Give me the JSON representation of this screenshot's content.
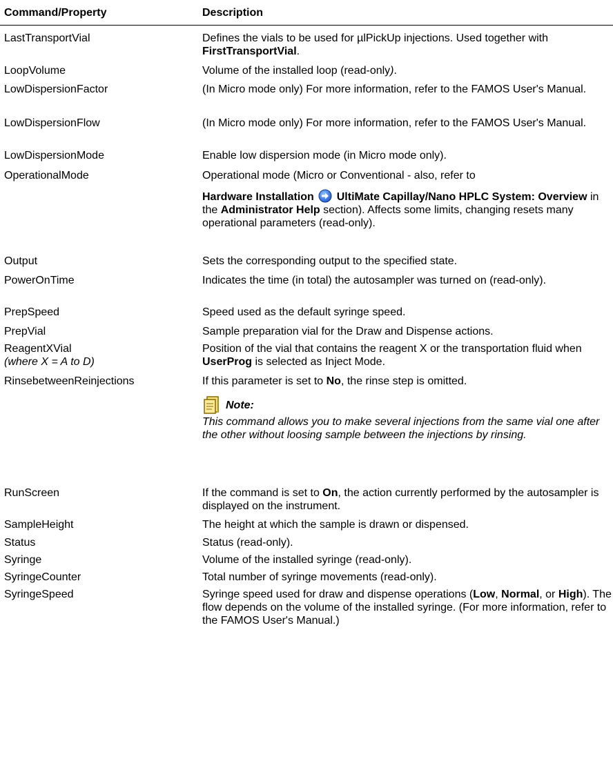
{
  "header": {
    "command_col": "Command/Property",
    "description_col": "Description"
  },
  "rows": [
    {
      "command": "LastTransportVial",
      "desc_1": "Defines the vials to be used for µlPickUp injections. Used together with ",
      "desc_bold_1": "FirstTransportVial",
      "desc_2": "."
    },
    {
      "command": "LoopVolume",
      "desc": "Volume of the installed loop (read-only",
      "desc_italic": ")",
      "desc_end": "."
    },
    {
      "command": "LowDispersionFactor",
      "desc": "(In Micro mode only) For more information, refer to the FAMOS User's Manual."
    },
    {
      "command": "LowDispersionFlow",
      "desc": "(In Micro mode only) For more information, refer to the FAMOS User's Manual."
    },
    {
      "command": "LowDispersionMode",
      "desc": "Enable low dispersion mode (in Micro mode only)."
    },
    {
      "command": "OperationalMode",
      "desc_1": "Operational mode (Micro or Conventional - also, refer to",
      "desc_bold_1": "Hardware Installation",
      "desc_bold_2": "UltiMate Capillay/Nano HPLC System: Overview",
      "desc_2": " in the ",
      "desc_bold_3": "Administrator Help",
      "desc_3": " section). Affects some limits, changing resets many operational parameters (read-only)."
    },
    {
      "command": "Output",
      "desc": "Sets the corresponding output to the specified state."
    },
    {
      "command": "PowerOnTime",
      "desc": "Indicates the time (in total) the autosampler was turned on (read-only)."
    },
    {
      "command": "PrepSpeed",
      "desc": "Speed used as the default syringe speed."
    },
    {
      "command": "PrepVial",
      "desc": "Sample preparation vial for the Draw and Dispense actions."
    },
    {
      "command": "ReagentXVial",
      "command_sub": "(where X = A to D)",
      "desc_1": "Position of the vial that contains the reagent X or the transportation fluid when ",
      "desc_bold_1": "UserProg",
      "desc_2": " is selected as Inject Mode."
    },
    {
      "command": "RinsebetweenReinjections",
      "desc_1": "If this parameter is set to ",
      "desc_bold_1": "No",
      "desc_2": ", the rinse step is omitted.",
      "note_title": "Note:",
      "note_text": "This command allows you to make several injections from the same vial one after the other without loosing sample between the injections by rinsing."
    },
    {
      "command": "RunScreen",
      "desc_1": "If the command is set to ",
      "desc_bold_1": "On",
      "desc_2": ", the action currently performed by the autosampler is displayed on the instrument."
    },
    {
      "command": "SampleHeight",
      "desc": "The height at which the sample is drawn or dispensed."
    },
    {
      "command": "Status",
      "desc": "Status (read-only)."
    },
    {
      "command": "Syringe",
      "desc": "Volume of the installed syringe (read-only)."
    },
    {
      "command": "SyringeCounter",
      "desc": "Total number of syringe movements (read-only)."
    },
    {
      "command": "SyringeSpeed",
      "desc_1": "Syringe speed used for draw and dispense operations (",
      "desc_bold_1": "Low",
      "desc_2": ", ",
      "desc_bold_2": "Normal",
      "desc_3": ", or ",
      "desc_bold_3": "High",
      "desc_4": "). The flow depends on the volume of the installed syringe. (For more information, refer to the FAMOS User's Manual.)"
    }
  ],
  "icons": {
    "link_arrow": "blue-arrow-icon",
    "note": "note-icon"
  },
  "colors": {
    "link_icon": "#1f5fd6",
    "note_icon": "#d9a21b"
  }
}
